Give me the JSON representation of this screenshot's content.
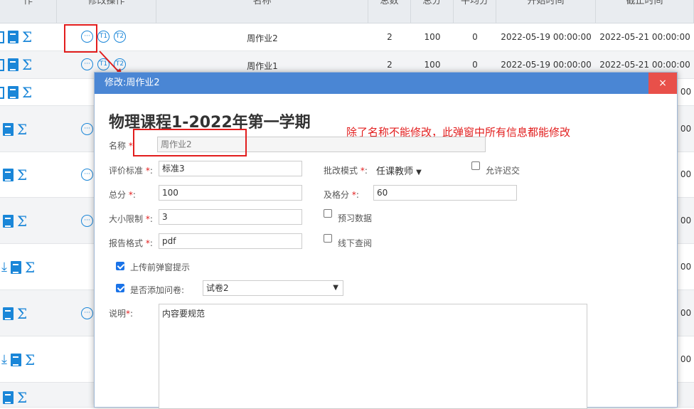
{
  "table": {
    "headers": {
      "actions": "作",
      "edit_ops": "修改操作",
      "name": "名称",
      "total_count": "总数",
      "total_score": "总分",
      "average": "平均分",
      "start_time": "开始时间",
      "end_time": "截止时间"
    },
    "rows": [
      {
        "name": "周作业2",
        "count": "2",
        "score": "100",
        "avg": "0",
        "start": "2022-05-19 00:00:00",
        "end": "2022-05-21 00:00:00"
      },
      {
        "name": "周作业1",
        "count": "2",
        "score": "100",
        "avg": "0",
        "start": "2022-05-19 00:00:00",
        "end": "2022-05-21 00:00:00"
      }
    ],
    "end_fragment": "00",
    "op_more_glyph": "···",
    "op_t1": "T1",
    "op_t2": "T2"
  },
  "modal": {
    "title": "修改:周作业2",
    "close": "×",
    "course_title": "物理课程1-2022年第一学期",
    "annotation": "除了名称不能修改，此弹窗中所有信息都能修改",
    "fields": {
      "name_label": "名称",
      "name_value": "周作业2",
      "criteria_label": "评价标准",
      "criteria_value": "标准3",
      "mode_label": "批改模式",
      "mode_value": "任课教师",
      "allow_late_label": "允许迟交",
      "score_label": "总分",
      "score_value": "100",
      "pass_label": "及格分",
      "pass_value": "60",
      "size_label": "大小限制",
      "size_value": "3",
      "preview_label": "预习数据",
      "format_label": "报告格式",
      "format_value": "pdf",
      "offline_label": "线下查阅",
      "upload_prompt_label": "上传前弹窗提示",
      "questionnaire_label": "是否添加问卷:",
      "questionnaire_value": "试卷2",
      "desc_label": "说明",
      "desc_value": "内容要规范"
    },
    "required_mark": "*",
    "colon": ":"
  },
  "colors": {
    "accent": "#1a86d8",
    "modal_header": "#4a86d4",
    "close_bg": "#e8504a",
    "annotation": "#e21d1d"
  }
}
